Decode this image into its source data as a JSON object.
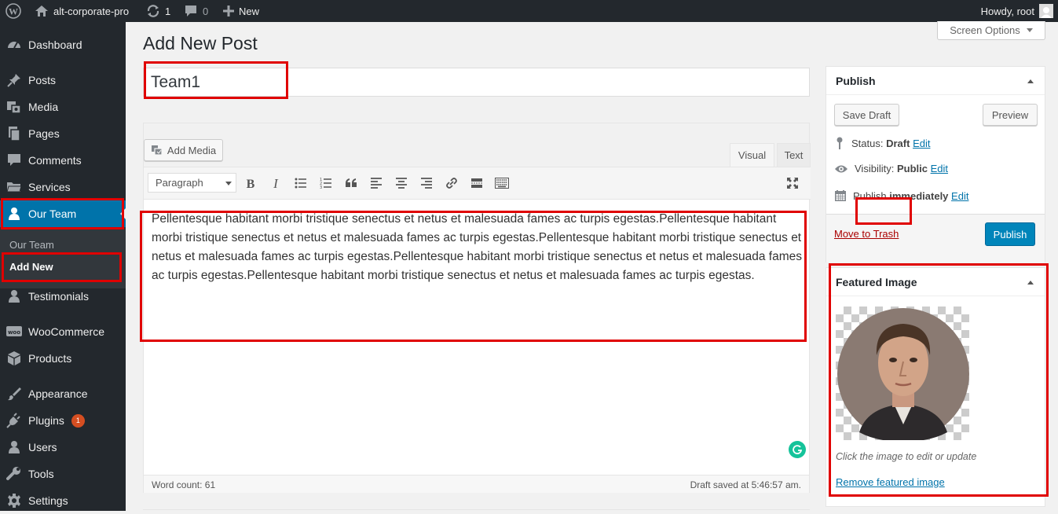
{
  "adminbar": {
    "site_name": "alt-corporate-pro",
    "updates_count": "1",
    "comments_count": "0",
    "new_label": "New",
    "howdy": "Howdy, root"
  },
  "sidebar": {
    "items": [
      {
        "label": "Dashboard",
        "icon": "dashboard-icon"
      },
      {
        "label": "Posts",
        "icon": "pin-icon"
      },
      {
        "label": "Media",
        "icon": "media-icon"
      },
      {
        "label": "Pages",
        "icon": "pages-icon"
      },
      {
        "label": "Comments",
        "icon": "comments-icon"
      },
      {
        "label": "Services",
        "icon": "folder-icon"
      },
      {
        "label": "Our Team",
        "icon": "person-icon"
      },
      {
        "label": "Testimonials",
        "icon": "person-icon"
      },
      {
        "label": "WooCommerce",
        "icon": "woo-icon"
      },
      {
        "label": "Products",
        "icon": "box-icon"
      },
      {
        "label": "Appearance",
        "icon": "brush-icon"
      },
      {
        "label": "Plugins",
        "icon": "plugin-icon"
      },
      {
        "label": "Users",
        "icon": "person-icon"
      },
      {
        "label": "Tools",
        "icon": "wrench-icon"
      },
      {
        "label": "Settings",
        "icon": "settings-icon"
      }
    ],
    "submenu": [
      "Our Team",
      "Add New"
    ],
    "plugins_badge": "1"
  },
  "page": {
    "title": "Add New Post",
    "screen_options": "Screen Options"
  },
  "post": {
    "title_value": "Team1"
  },
  "editor": {
    "add_media": "Add Media",
    "tab_visual": "Visual",
    "tab_text": "Text",
    "format_select": "Paragraph",
    "content": "Pellentesque habitant morbi tristique senectus et netus et malesuada fames ac turpis egestas.Pellentesque habitant morbi tristique senectus et netus et malesuada fames ac turpis egestas.Pellentesque habitant morbi tristique senectus et netus et malesuada fames ac turpis egestas.Pellentesque habitant morbi tristique senectus et netus et malesuada fames ac turpis egestas.Pellentesque habitant morbi tristique senectus et netus et malesuada fames ac turpis egestas.",
    "word_count": "Word count: 61",
    "draft_saved": "Draft saved at 5:46:57 am."
  },
  "publish": {
    "title": "Publish",
    "save_draft": "Save Draft",
    "preview": "Preview",
    "status_label": "Status:",
    "status_value": "Draft",
    "visibility_label": "Visibility:",
    "visibility_value": "Public",
    "publish_label": "Publish",
    "publish_value": "immediately",
    "edit": "Edit",
    "move_to_trash": "Move to Trash",
    "publish_button": "Publish"
  },
  "featured": {
    "title": "Featured Image",
    "hint": "Click the image to edit or update",
    "remove": "Remove featured image"
  },
  "colors": {
    "accent": "#0073aa",
    "sidebar_bg": "#23282d",
    "highlight": "#e00000"
  }
}
